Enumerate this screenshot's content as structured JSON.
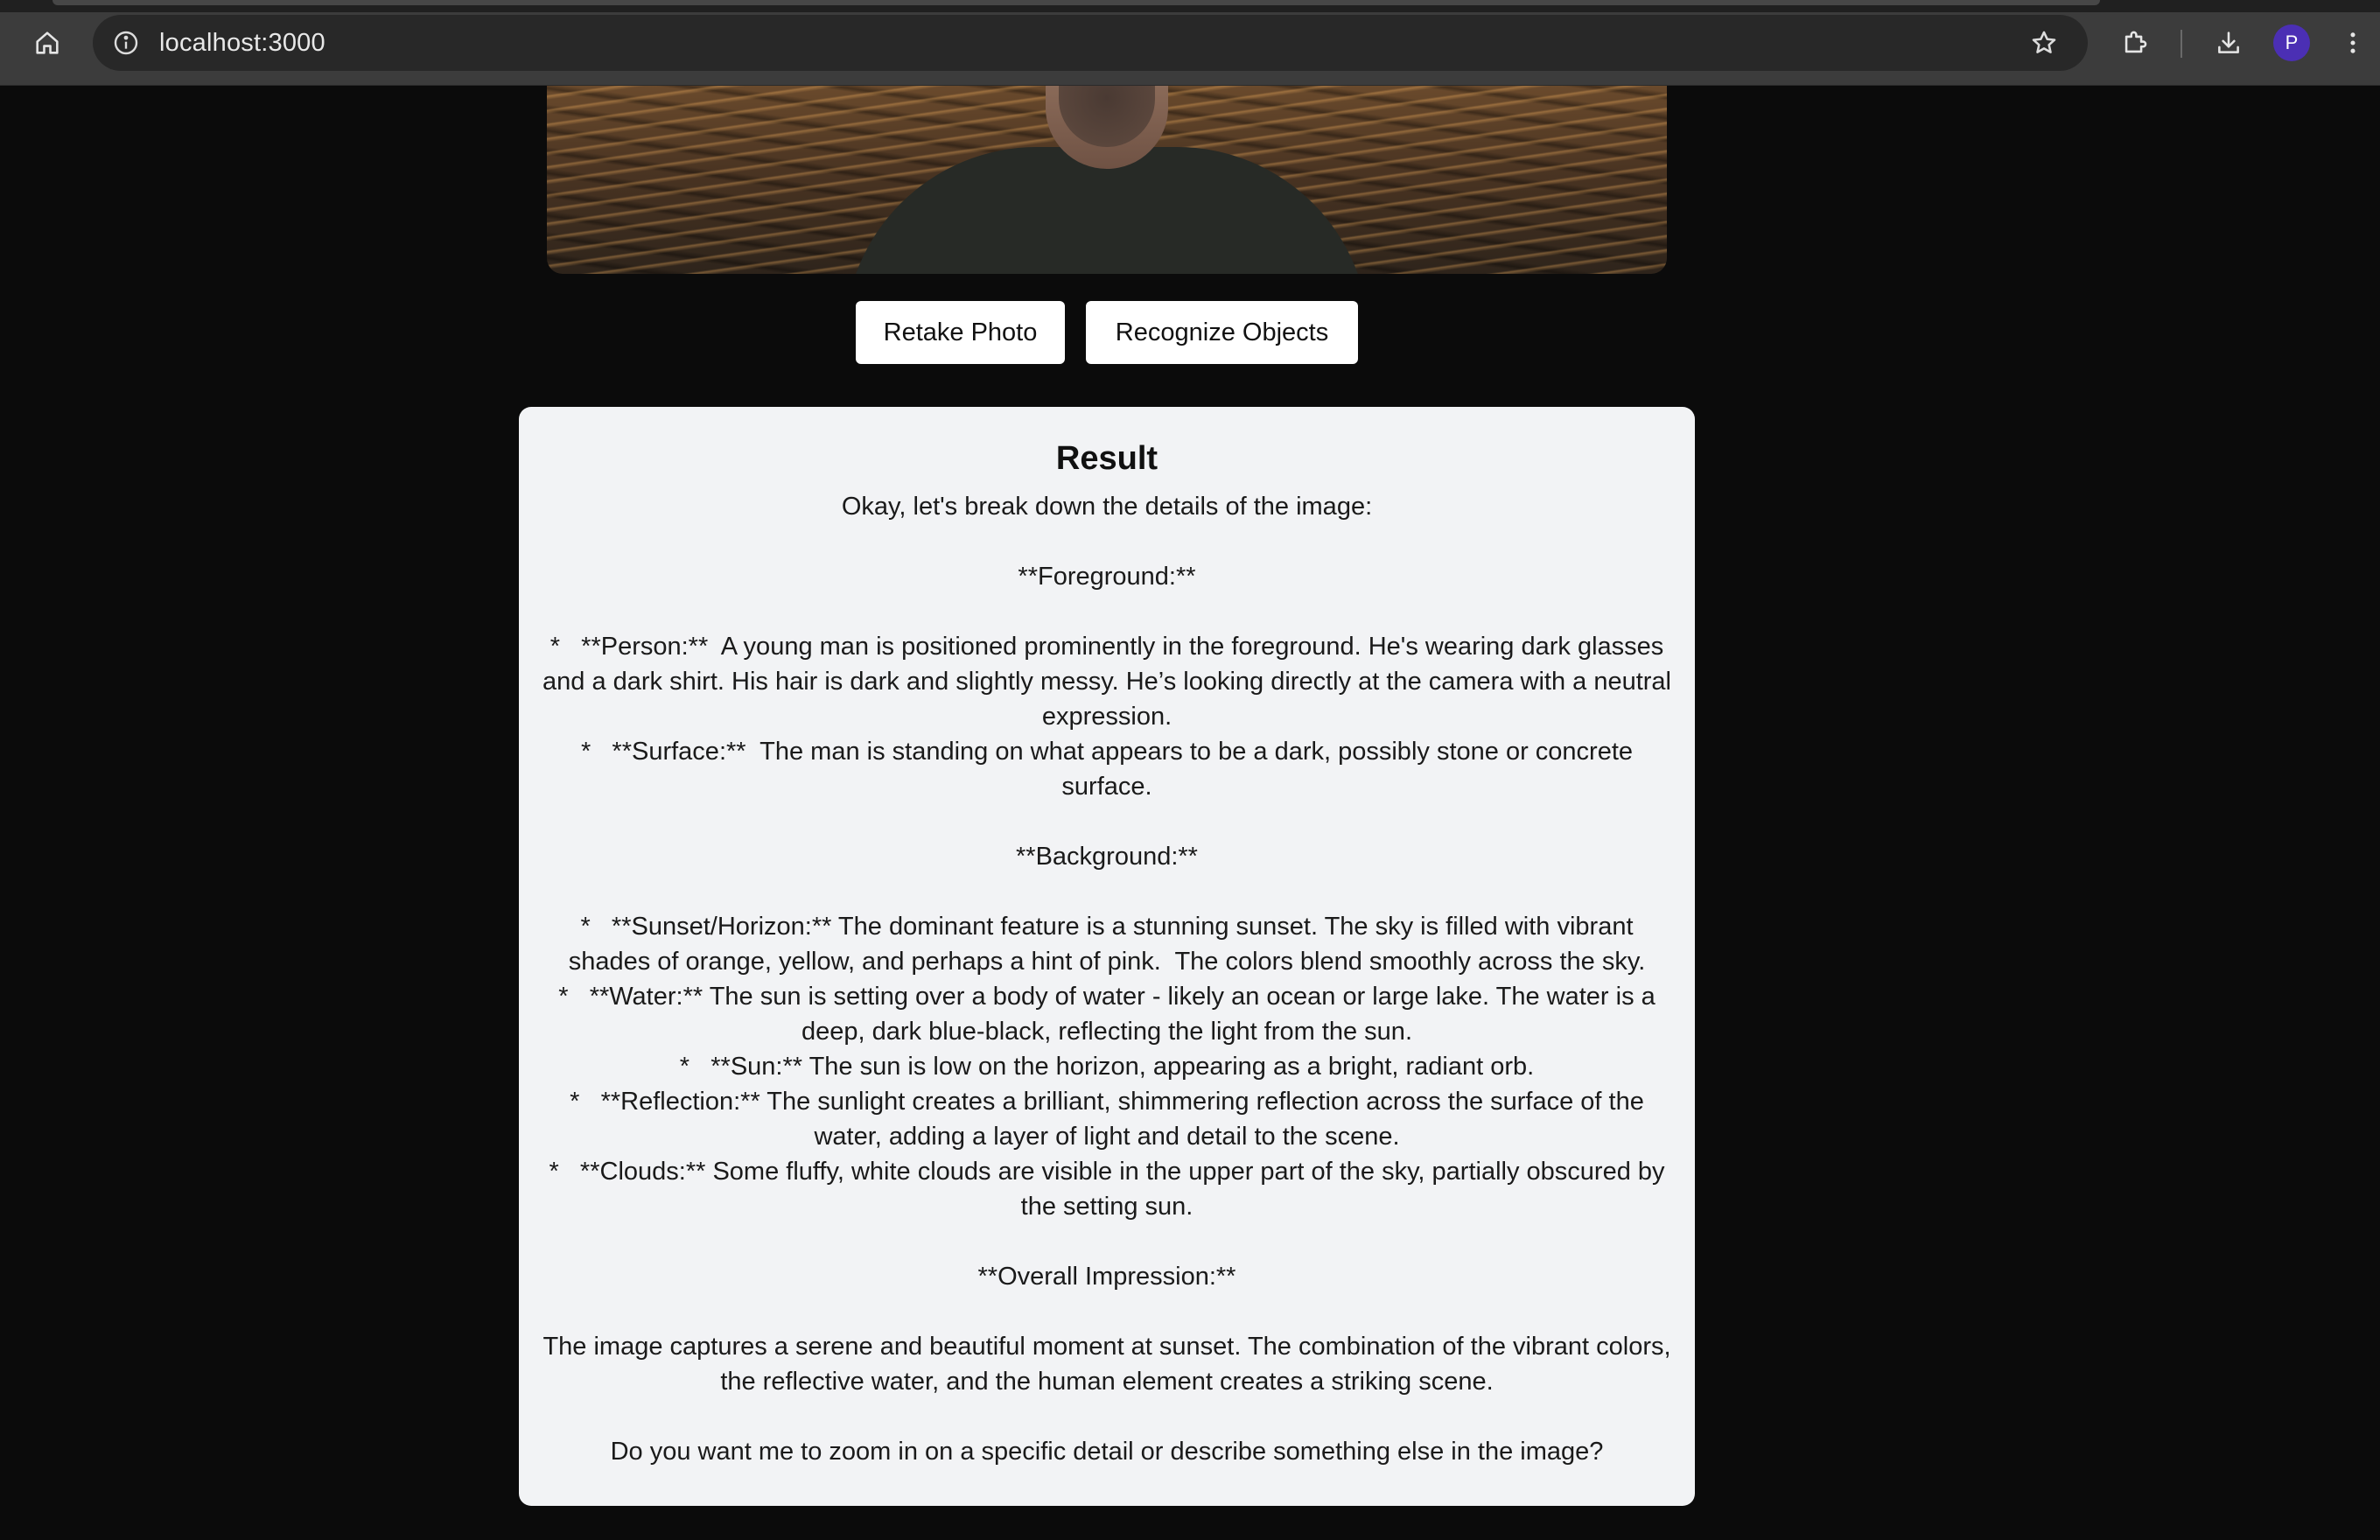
{
  "browser": {
    "url": "localhost:3000",
    "profile_initial": "P",
    "icons": {
      "home": "home-icon",
      "site_info": "info-icon",
      "bookmark": "star-icon",
      "extensions": "puzzle-icon",
      "downloads": "download-icon",
      "menu": "kebab-menu-icon"
    },
    "colors": {
      "toolbar": "#3c3c3c",
      "omnibox": "#282828",
      "avatar": "#4b2fb4"
    }
  },
  "page": {
    "background": "#0b0b0b",
    "buttons": {
      "retake_label": "Retake Photo",
      "recognize_label": "Recognize Objects"
    },
    "result": {
      "title": "Result",
      "text": "Okay, let's break down the details of the image:\n\n**Foreground:**\n\n*   **Person:**  A young man is positioned prominently in the foreground. He's wearing dark glasses and a dark shirt. His hair is dark and slightly messy. He’s looking directly at the camera with a neutral expression.\n*   **Surface:**  The man is standing on what appears to be a dark, possibly stone or concrete surface.\n\n**Background:**\n\n*   **Sunset/Horizon:** The dominant feature is a stunning sunset. The sky is filled with vibrant shades of orange, yellow, and perhaps a hint of pink.  The colors blend smoothly across the sky.\n*   **Water:** The sun is setting over a body of water - likely an ocean or large lake. The water is a deep, dark blue-black, reflecting the light from the sun.\n*   **Sun:** The sun is low on the horizon, appearing as a bright, radiant orb.\n*   **Reflection:** The sunlight creates a brilliant, shimmering reflection across the surface of the water, adding a layer of light and detail to the scene.\n*   **Clouds:** Some fluffy, white clouds are visible in the upper part of the sky, partially obscured by the setting sun.\n\n**Overall Impression:**\n\nThe image captures a serene and beautiful moment at sunset. The combination of the vibrant colors, the reflective water, and the human element creates a striking scene.\n\nDo you want me to zoom in on a specific detail or describe something else in the image?"
    }
  }
}
